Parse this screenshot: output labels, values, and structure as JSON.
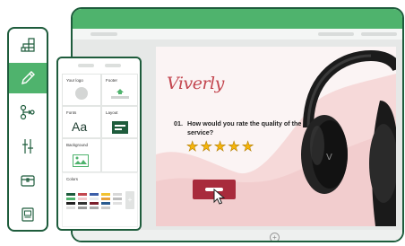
{
  "slide": {
    "logo_text": "Viverly",
    "question_number": "01.",
    "question_text": "How would you rate the quality of the service?",
    "rating": 5,
    "rating_max": 5
  },
  "panel": {
    "your_logo_label": "Your logo",
    "footer_label": "Footer",
    "fonts_label": "Fonts",
    "fonts_sample": "Aa",
    "layout_label": "Layout",
    "background_label": "Background",
    "colors_label": "Colors"
  },
  "toolbar": {
    "tools": [
      "grid-icon",
      "pencil-icon",
      "branch-icon",
      "sliders-icon",
      "chest-icon",
      "page-icon"
    ]
  },
  "colors": {
    "accent_green": "#4fb36d",
    "dark_green": "#1e5c3c",
    "brand_red": "#c3464f",
    "button_red": "#a82b3c",
    "star_yellow": "#f5b40b"
  }
}
